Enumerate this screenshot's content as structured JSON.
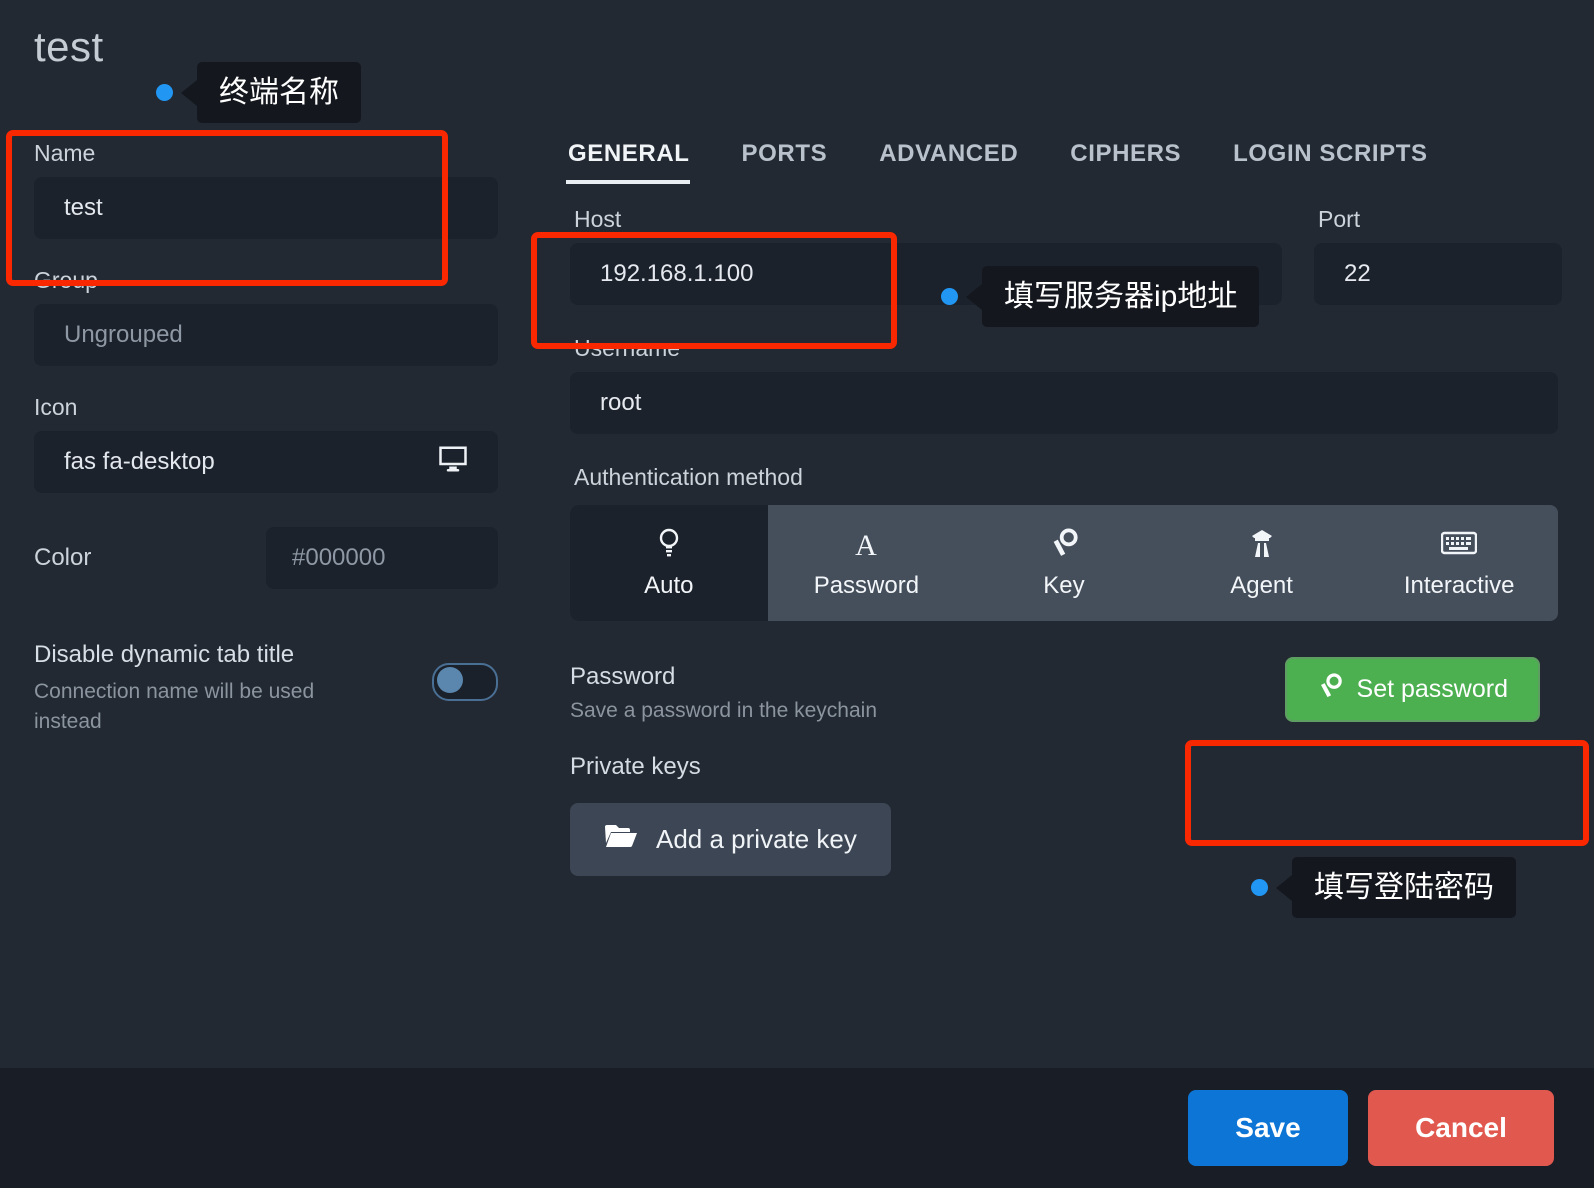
{
  "window": {
    "connection_title": "test"
  },
  "left": {
    "name": {
      "label": "Name",
      "value": "test"
    },
    "group": {
      "label": "Group",
      "value": "Ungrouped"
    },
    "icon": {
      "label": "Icon",
      "value": "fas fa-desktop",
      "preview_icon": "desktop-monitor-icon"
    },
    "color": {
      "label": "Color",
      "value": "#000000"
    },
    "dynamic_tab": {
      "title": "Disable dynamic tab title",
      "subtitle": "Connection name will be used instead",
      "enabled": false
    }
  },
  "tabs": [
    {
      "label": "GENERAL",
      "active": true
    },
    {
      "label": "PORTS",
      "active": false
    },
    {
      "label": "ADVANCED",
      "active": false
    },
    {
      "label": "CIPHERS",
      "active": false
    },
    {
      "label": "LOGIN SCRIPTS",
      "active": false
    }
  ],
  "general": {
    "host": {
      "label": "Host",
      "value": "192.168.1.100"
    },
    "port": {
      "label": "Port",
      "value": "22"
    },
    "username": {
      "label": "Username",
      "value": "root"
    },
    "auth": {
      "label": "Authentication method",
      "options": [
        {
          "label": "Auto",
          "icon": "lightbulb-icon",
          "selected": false
        },
        {
          "label": "Password",
          "icon": "letter-a-icon",
          "selected": true
        },
        {
          "label": "Key",
          "icon": "key-icon",
          "selected": false
        },
        {
          "label": "Agent",
          "icon": "agent-icon",
          "selected": false
        },
        {
          "label": "Interactive",
          "icon": "keyboard-icon",
          "selected": false
        }
      ]
    },
    "password": {
      "title": "Password",
      "subtitle": "Save a password in the keychain",
      "button_label": "Set password",
      "button_icon": "key-icon",
      "button_color": "#4caf50"
    },
    "private_keys": {
      "title": "Private keys",
      "add_button_label": "Add a private key",
      "add_button_icon": "folder-open-icon"
    }
  },
  "footer": {
    "save_label": "Save",
    "cancel_label": "Cancel",
    "save_color": "#0d75d6",
    "cancel_color": "#e1584f"
  },
  "annotations": {
    "highlight_color": "#fa2800",
    "dot_color": "#2196f3",
    "callouts": [
      {
        "text": "终端名称"
      },
      {
        "text": "填写服务器ip地址"
      },
      {
        "text": "填写登陆密码"
      }
    ]
  }
}
